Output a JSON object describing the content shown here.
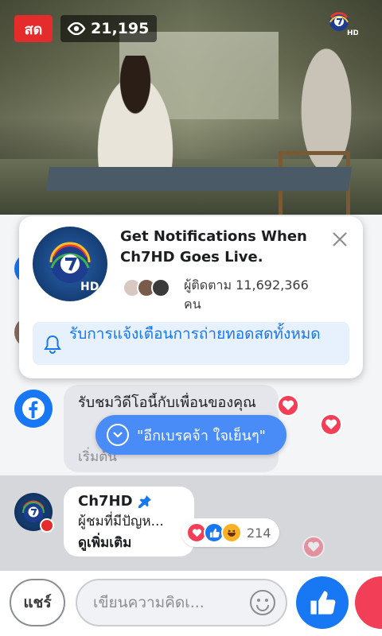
{
  "video": {
    "live_label": "สด",
    "view_count": "21,195"
  },
  "popup": {
    "title": "Get Notifications When Ch7HD Goes Live.",
    "followers": "ผู้ติดตาม 11,692,366 คน",
    "notify_button": "รับการแจ้งเตือนการถ่ายทอดสดทั้งหมด"
  },
  "comments": [
    {
      "text": "รับชมวิดีโอนี้กับเพื่อนของคุณ",
      "link": "เริ่มต้น"
    },
    {
      "author": "Ch7HD",
      "message": "ผู้ชมที่มีปัญห...",
      "see_more": "ดูเพิ่มเติม",
      "reaction_count": "214"
    }
  ],
  "pill": {
    "label": "\"อีกเบรคจ้า ใจเย็นๆ\""
  },
  "bottom": {
    "share_label": "แชร์",
    "comment_placeholder": "เขียนความคิดเ..."
  },
  "colors": {
    "facebook_blue": "#1877f2",
    "live_red": "#e42c2c",
    "love_red": "#f33e58",
    "haha_yellow": "#f7b125"
  }
}
